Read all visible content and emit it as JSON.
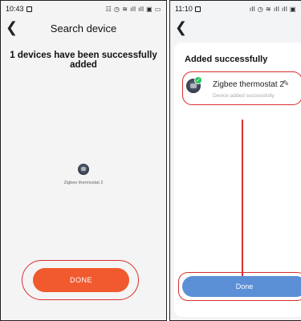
{
  "left": {
    "status": {
      "time": "10:43",
      "icons": " 🔔 ⦿ ≢ .ıll .ıll ▦ ▭"
    },
    "nav": {
      "back_icon": "chevron-left-icon",
      "title": "Search device"
    },
    "message": "1 devices have been successfully added",
    "device": {
      "name": "Zigbee thermostat 2"
    },
    "done_label": "DONE",
    "accent_color": "#f05a2e"
  },
  "right": {
    "status": {
      "time": "11:10",
      "icons": " .ıll ⦿ ≢ .ıll .ıll ▦"
    },
    "nav": {
      "back_icon": "chevron-left-icon"
    },
    "section_title": "Added successfully",
    "device": {
      "name": "Zigbee thermostat 2",
      "status": "Device added successfully"
    },
    "done_label": "Done",
    "accent_color": "#5b8fd6"
  },
  "annotation_color": "#d93030"
}
